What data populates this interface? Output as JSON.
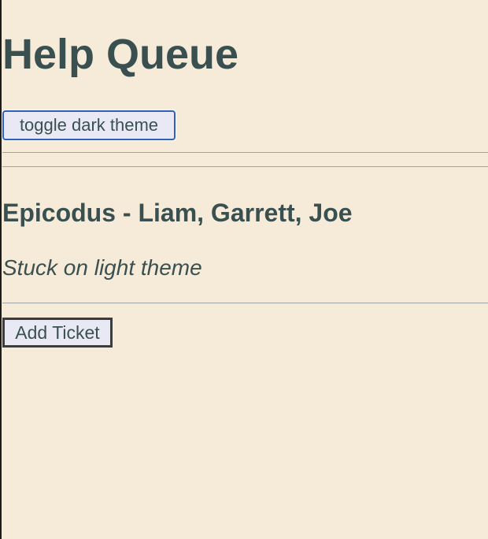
{
  "header": {
    "title": "Help Queue",
    "theme_toggle_label": "toggle dark theme"
  },
  "tickets": [
    {
      "names": "Epicodus - Liam, Garrett, Joe",
      "issue": "Stuck on light theme"
    }
  ],
  "actions": {
    "add_ticket_label": "Add Ticket"
  },
  "colors": {
    "background": "#f6ebd9",
    "text": "#3a5050",
    "button_bg": "#e9e9f6",
    "focus_border": "#2f5fb8",
    "divider": "#9da4a4"
  }
}
